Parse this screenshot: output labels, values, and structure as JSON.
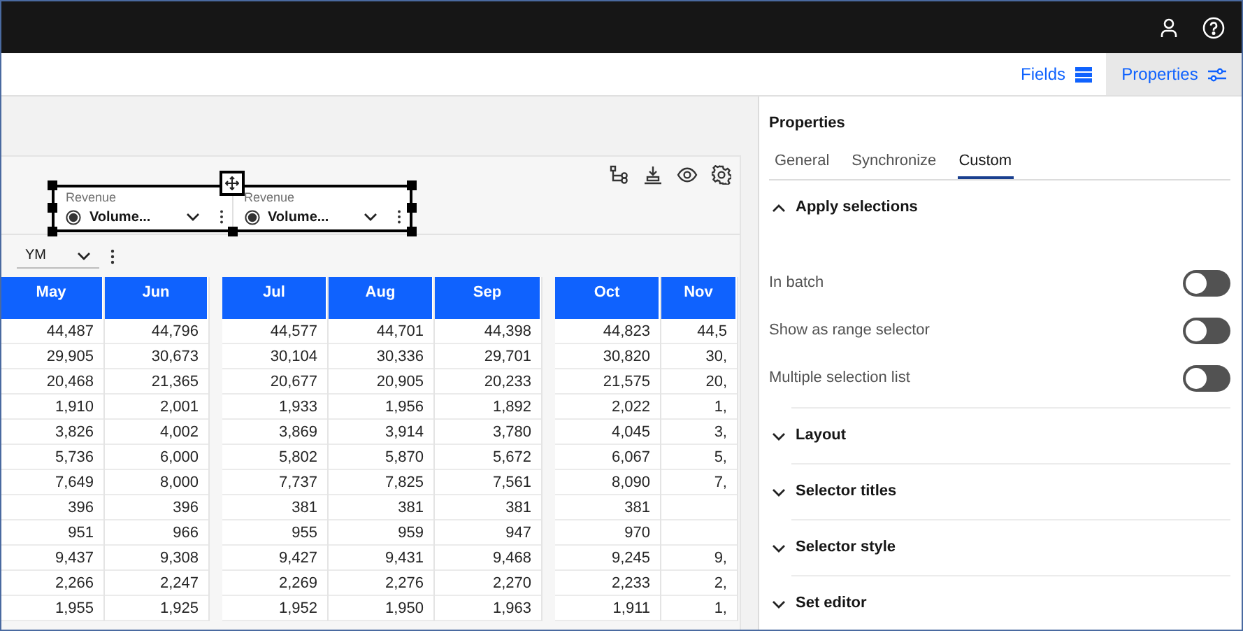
{
  "header_tabs": [
    {
      "label": "Fields",
      "selected": false
    },
    {
      "label": "Properties",
      "selected": true
    }
  ],
  "canvas": {
    "selectors": [
      {
        "title": "Revenue",
        "value": "Volume..."
      },
      {
        "title": "Revenue",
        "value": "Volume..."
      }
    ],
    "period_dropdown": {
      "value": "YM"
    },
    "table": {
      "groups": [
        [
          "May",
          "Jun"
        ],
        [
          "Jul",
          "Aug",
          "Sep"
        ],
        [
          "Oct",
          "Nov"
        ]
      ],
      "rows": [
        [
          "44,487",
          "44,796",
          "44,577",
          "44,701",
          "44,398",
          "44,823",
          "44,5"
        ],
        [
          "29,905",
          "30,673",
          "30,104",
          "30,336",
          "29,701",
          "30,820",
          "30,"
        ],
        [
          "20,468",
          "21,365",
          "20,677",
          "20,905",
          "20,233",
          "21,575",
          "20,"
        ],
        [
          "1,910",
          "2,001",
          "1,933",
          "1,956",
          "1,892",
          "2,022",
          "1,"
        ],
        [
          "3,826",
          "4,002",
          "3,869",
          "3,914",
          "3,780",
          "4,045",
          "3,"
        ],
        [
          "5,736",
          "6,000",
          "5,802",
          "5,870",
          "5,672",
          "6,067",
          "5,"
        ],
        [
          "7,649",
          "8,000",
          "7,737",
          "7,825",
          "7,561",
          "8,090",
          "7,"
        ],
        [
          "396",
          "396",
          "381",
          "381",
          "381",
          "381",
          null
        ],
        [
          "951",
          "966",
          "955",
          "959",
          "947",
          "970",
          null
        ],
        [
          "9,437",
          "9,308",
          "9,427",
          "9,431",
          "9,468",
          "9,245",
          "9,"
        ],
        [
          "2,266",
          "2,247",
          "2,269",
          "2,276",
          "2,270",
          "2,233",
          "2,"
        ],
        [
          "1,955",
          "1,925",
          "1,952",
          "1,950",
          "1,963",
          "1,911",
          "1,"
        ]
      ]
    }
  },
  "properties_panel": {
    "title": "Properties",
    "tabs": [
      {
        "label": "General",
        "selected": false
      },
      {
        "label": "Synchronize",
        "selected": false
      },
      {
        "label": "Custom",
        "selected": true
      }
    ],
    "sections": [
      {
        "title": "Apply selections",
        "expanded": true,
        "settings": [
          {
            "label": "In batch",
            "on": false
          },
          {
            "label": "Show as range selector",
            "on": false
          },
          {
            "label": "Multiple selection list",
            "on": false
          }
        ]
      },
      {
        "title": "Layout",
        "expanded": false
      },
      {
        "title": "Selector titles",
        "expanded": false
      },
      {
        "title": "Selector style",
        "expanded": false
      },
      {
        "title": "Set editor",
        "expanded": false
      }
    ]
  }
}
